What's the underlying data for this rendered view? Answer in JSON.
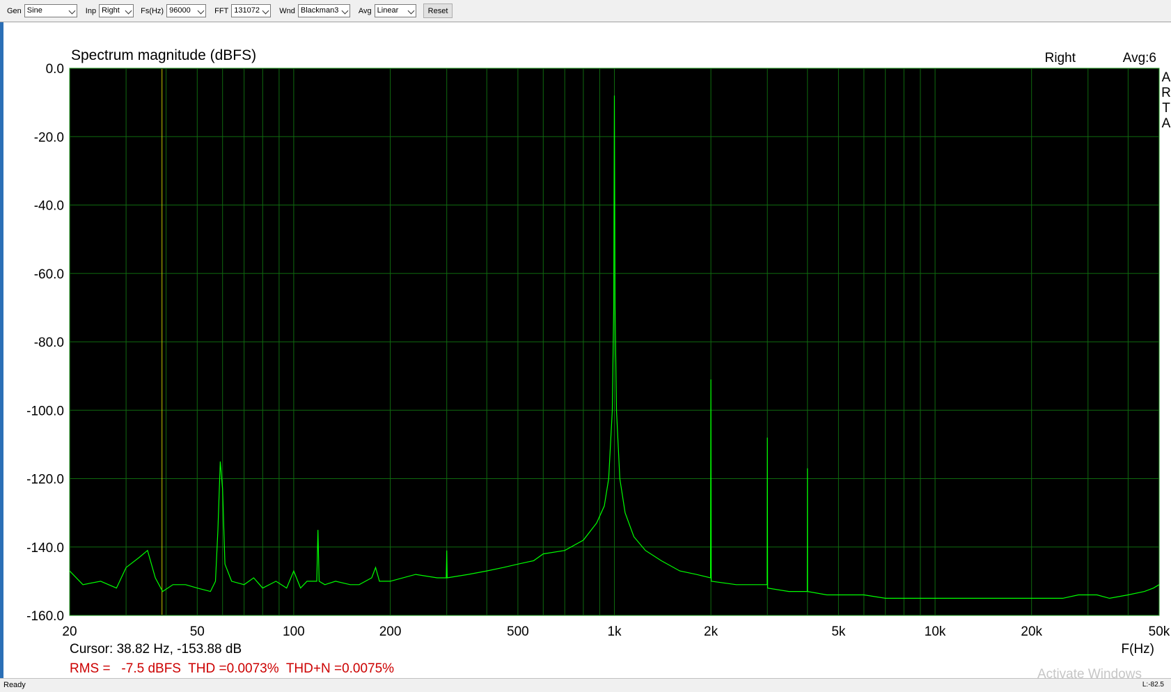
{
  "toolbar": {
    "controls": [
      {
        "label": "Gen",
        "value": "Sine"
      },
      {
        "label": "Inp",
        "value": "Right"
      },
      {
        "label": "Fs(Hz)",
        "value": "96000"
      },
      {
        "label": "FFT",
        "value": "131072"
      },
      {
        "label": "Wnd",
        "value": "Blackman3"
      },
      {
        "label": "Avg",
        "value": "Linear"
      }
    ],
    "reset_label": "Reset"
  },
  "chart_data": {
    "type": "line",
    "title": "Spectrum magnitude (dBFS)",
    "channel_label": "Right",
    "avg_label": "Avg:6",
    "brand_letters": [
      "A",
      "R",
      "T",
      "A"
    ],
    "xlabel": "F(Hz)",
    "x_scale": "log",
    "xlim": [
      20,
      50000
    ],
    "ylim": [
      -160,
      0
    ],
    "x_ticks": [
      {
        "value": 20,
        "label": "20"
      },
      {
        "value": 50,
        "label": "50"
      },
      {
        "value": 100,
        "label": "100"
      },
      {
        "value": 200,
        "label": "200"
      },
      {
        "value": 500,
        "label": "500"
      },
      {
        "value": 1000,
        "label": "1k"
      },
      {
        "value": 2000,
        "label": "2k"
      },
      {
        "value": 5000,
        "label": "5k"
      },
      {
        "value": 10000,
        "label": "10k"
      },
      {
        "value": 20000,
        "label": "20k"
      },
      {
        "value": 50000,
        "label": "50k"
      }
    ],
    "y_ticks": [
      {
        "value": 0,
        "label": "0.0"
      },
      {
        "value": -20,
        "label": "-20.0"
      },
      {
        "value": -40,
        "label": "-40.0"
      },
      {
        "value": -60,
        "label": "-60.0"
      },
      {
        "value": -80,
        "label": "-80.0"
      },
      {
        "value": -100,
        "label": "-100.0"
      },
      {
        "value": -120,
        "label": "-120.0"
      },
      {
        "value": -140,
        "label": "-140.0"
      },
      {
        "value": -160,
        "label": "-160.0"
      }
    ],
    "grid": true,
    "cursor_x": 38.82,
    "cursor_text": "Cursor: 38.82 Hz, -153.88 dB",
    "measure_text": "RMS =   -7.5 dBFS  THD =0.0073%  THD+N =0.0075%",
    "colors": {
      "background": "#000000",
      "trace": "#00ff00",
      "grid": "#0f6a0f",
      "cursor": "#c8c800",
      "measure": "#cc0000"
    },
    "series": [
      {
        "values": [
          [
            20,
            -147
          ],
          [
            22,
            -151
          ],
          [
            25,
            -150
          ],
          [
            28,
            -152
          ],
          [
            30,
            -146
          ],
          [
            33,
            -143
          ],
          [
            35,
            -141
          ],
          [
            37,
            -149
          ],
          [
            39,
            -153
          ],
          [
            42,
            -151
          ],
          [
            46,
            -151
          ],
          [
            50,
            -152
          ],
          [
            55,
            -153
          ],
          [
            57,
            -150
          ],
          [
            58,
            -135
          ],
          [
            59,
            -115
          ],
          [
            60,
            -123
          ],
          [
            61,
            -145
          ],
          [
            64,
            -150
          ],
          [
            70,
            -151
          ],
          [
            75,
            -149
          ],
          [
            80,
            -152
          ],
          [
            88,
            -150
          ],
          [
            95,
            -152
          ],
          [
            100,
            -147
          ],
          [
            105,
            -152
          ],
          [
            110,
            -150
          ],
          [
            118,
            -150
          ],
          [
            119,
            -135
          ],
          [
            120,
            -150
          ],
          [
            125,
            -151
          ],
          [
            135,
            -150
          ],
          [
            150,
            -151
          ],
          [
            160,
            -151
          ],
          [
            175,
            -149
          ],
          [
            180,
            -146
          ],
          [
            185,
            -150
          ],
          [
            200,
            -150
          ],
          [
            240,
            -148
          ],
          [
            280,
            -149
          ],
          [
            299,
            -149
          ],
          [
            300,
            -141
          ],
          [
            301,
            -149
          ],
          [
            350,
            -148
          ],
          [
            400,
            -147
          ],
          [
            450,
            -146
          ],
          [
            500,
            -145
          ],
          [
            560,
            -144
          ],
          [
            600,
            -142
          ],
          [
            700,
            -141
          ],
          [
            800,
            -138
          ],
          [
            880,
            -133
          ],
          [
            930,
            -128
          ],
          [
            960,
            -120
          ],
          [
            985,
            -100
          ],
          [
            995,
            -70
          ],
          [
            1000,
            -8
          ],
          [
            1005,
            -70
          ],
          [
            1015,
            -100
          ],
          [
            1040,
            -120
          ],
          [
            1080,
            -130
          ],
          [
            1150,
            -137
          ],
          [
            1250,
            -141
          ],
          [
            1400,
            -144
          ],
          [
            1600,
            -147
          ],
          [
            1800,
            -148
          ],
          [
            1995,
            -149
          ],
          [
            2000,
            -91
          ],
          [
            2005,
            -150
          ],
          [
            2400,
            -151
          ],
          [
            2995,
            -151
          ],
          [
            3000,
            -108
          ],
          [
            3005,
            -152
          ],
          [
            3500,
            -153
          ],
          [
            3995,
            -153
          ],
          [
            4000,
            -117
          ],
          [
            4005,
            -153
          ],
          [
            4600,
            -154
          ],
          [
            5000,
            -154
          ],
          [
            6000,
            -154
          ],
          [
            7000,
            -155
          ],
          [
            8000,
            -155
          ],
          [
            10000,
            -155
          ],
          [
            12000,
            -155
          ],
          [
            15000,
            -155
          ],
          [
            20000,
            -155
          ],
          [
            25000,
            -155
          ],
          [
            28000,
            -154
          ],
          [
            32000,
            -154
          ],
          [
            35000,
            -155
          ],
          [
            40000,
            -154
          ],
          [
            45000,
            -153
          ],
          [
            48000,
            -152
          ],
          [
            50000,
            -151
          ]
        ]
      }
    ]
  },
  "statusbar": {
    "left": "Ready",
    "right": "L:-82.5"
  },
  "overlay": {
    "watermark": "Activate Windows"
  }
}
